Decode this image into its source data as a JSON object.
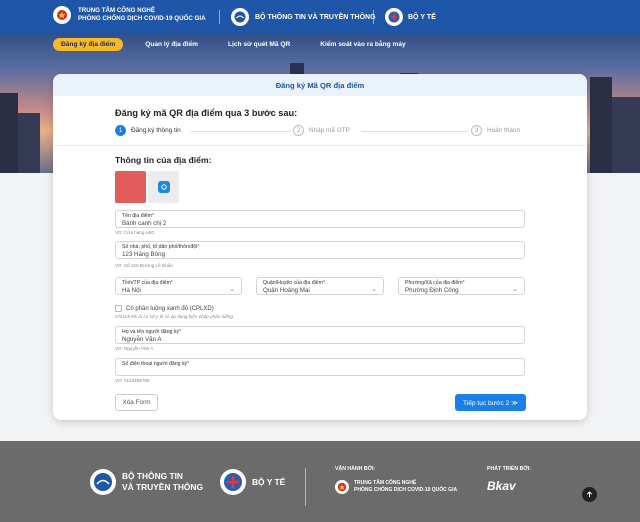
{
  "header": {
    "brand1_line1": "TRUNG TÂM CÔNG NGHỆ",
    "brand1_line2": "PHÒNG CHỐNG DỊCH COVID-19 QUỐC GIA",
    "brand2": "BỘ THÔNG TIN VÀ TRUYỀN THÔNG",
    "brand3": "BỘ Y TẾ"
  },
  "nav": {
    "items": [
      {
        "label": "Đăng ký địa điểm",
        "active": true
      },
      {
        "label": "Quản lý địa điểm"
      },
      {
        "label": "Lịch sử quét Mã QR"
      },
      {
        "label": "Kiểm soát vào ra bằng máy"
      }
    ]
  },
  "card": {
    "title": "Đăng ký Mã QR địa điểm",
    "heading": "Đăng ký mã QR địa điểm qua 3 bước sau:",
    "steps": [
      {
        "num": "1",
        "label": "Đăng ký thông tin"
      },
      {
        "num": "2",
        "label": "Nhập mã OTP"
      },
      {
        "num": "3",
        "label": "Hoàn thành"
      }
    ],
    "section_title": "Thông tin của địa điểm:",
    "fields": {
      "name": {
        "label": "Tên địa điểm",
        "value": "Bánh canh chị 2",
        "hint": "VD: Cửa hàng ABC"
      },
      "address": {
        "label": "Số nhà, phố, tổ dân phố/thôn/đội",
        "value": "123 Hàng Bông",
        "hint": "VD: Số 125 Đường Lê Duẩn"
      },
      "province": {
        "label": "Tỉnh/TP của địa điểm",
        "value": "Hà Nội"
      },
      "district": {
        "label": "Quận/Huyện của địa điểm",
        "value": "Quận Hoàng Mai"
      },
      "ward": {
        "label": "Phường/Xã của địa điểm",
        "value": "Phường Định Công"
      },
      "manager": {
        "label": "Họ và tên người đăng ký",
        "value": "Nguyễn Văn A",
        "hint": "VD: Nguyễn Văn A"
      },
      "phone": {
        "label": "Số điện thoại người đăng ký",
        "value": "",
        "hint": "VD: 0123456789"
      }
    },
    "checkbox_label": "Có phần luồng xanh đỏ (CPLXD)",
    "checkbox_hint": "Chỉ tick khi là cơ sở y tế có áp dụng biện pháp phân luồng",
    "clear_button": "Xóa Form",
    "next_button": "Tiếp tục bước 2 ≫"
  },
  "footer": {
    "ministry1_line1": "BỘ THÔNG TIN",
    "ministry1_line2": "VÀ TRUYỀN THÔNG",
    "ministry2": "BỘ Y TẾ",
    "operated_by": "VẬN HÀNH BỞI:",
    "operator_line1": "TRUNG TÂM CÔNG NGHỆ",
    "operator_line2": "PHÒNG CHỐNG DỊCH COVID-19 QUỐC GIA",
    "developed_by": "PHÁT TRIỂN BỞI:",
    "developer": "Bkav"
  },
  "colors": {
    "primary": "#1a7fe6",
    "header": "#1f56a8",
    "accent": "#f7b82b",
    "footer": "#6b6b6b"
  }
}
